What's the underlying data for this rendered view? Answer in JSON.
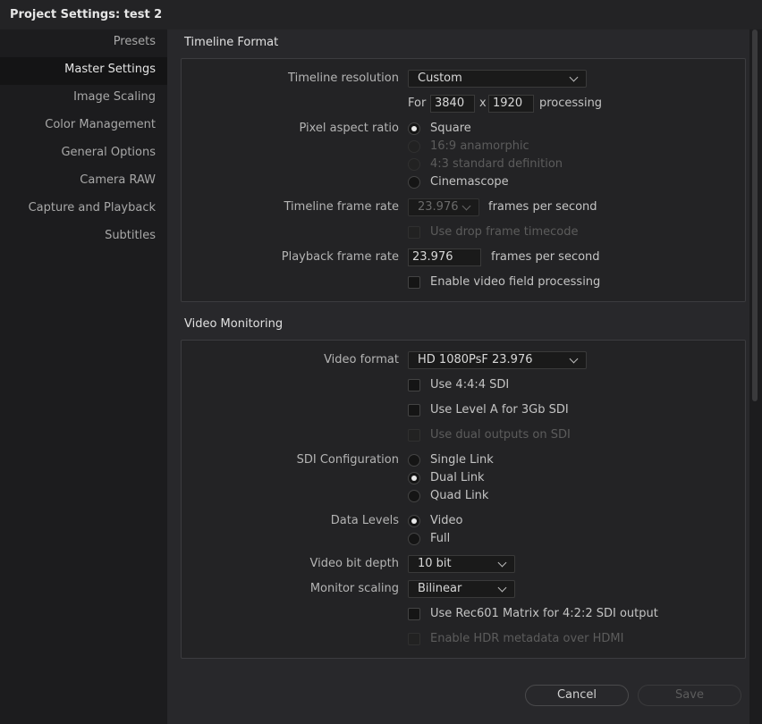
{
  "window": {
    "title": "Project Settings:  test 2"
  },
  "sidebar": {
    "items": [
      {
        "label": "Presets"
      },
      {
        "label": "Master Settings"
      },
      {
        "label": "Image Scaling"
      },
      {
        "label": "Color Management"
      },
      {
        "label": "General Options"
      },
      {
        "label": "Camera RAW"
      },
      {
        "label": "Capture and Playback"
      },
      {
        "label": "Subtitles"
      }
    ],
    "active": "Master Settings"
  },
  "timeline_format": {
    "title": "Timeline Format",
    "resolution_label": "Timeline resolution",
    "resolution_value": "Custom",
    "for_label": "For",
    "width": "3840",
    "x_label": "x",
    "height": "1920",
    "processing_label": "processing",
    "par_label": "Pixel aspect ratio",
    "par_options": [
      {
        "label": "Square",
        "selected": true,
        "enabled": true
      },
      {
        "label": "16:9 anamorphic",
        "selected": false,
        "enabled": false
      },
      {
        "label": "4:3 standard definition",
        "selected": false,
        "enabled": false
      },
      {
        "label": "Cinemascope",
        "selected": false,
        "enabled": true
      }
    ],
    "frame_rate_label": "Timeline frame rate",
    "frame_rate_value": "23.976",
    "fps_label": "frames per second",
    "drop_frame_label": "Use drop frame timecode",
    "playback_rate_label": "Playback frame rate",
    "playback_rate_value": "23.976",
    "playback_fps_label": "frames per second",
    "field_processing_label": "Enable video field processing"
  },
  "video_monitoring": {
    "title": "Video Monitoring",
    "format_label": "Video format",
    "format_value": "HD 1080PsF 23.976",
    "use_444_label": "Use 4:4:4 SDI",
    "use_level_a_label": "Use Level A for 3Gb SDI",
    "dual_outputs_label": "Use dual outputs on SDI",
    "sdi_config_label": "SDI Configuration",
    "sdi_options": [
      {
        "label": "Single Link",
        "selected": false
      },
      {
        "label": "Dual Link",
        "selected": true
      },
      {
        "label": "Quad Link",
        "selected": false
      }
    ],
    "data_levels_label": "Data Levels",
    "data_level_options": [
      {
        "label": "Video",
        "selected": true
      },
      {
        "label": "Full",
        "selected": false
      }
    ],
    "bit_depth_label": "Video bit depth",
    "bit_depth_value": "10 bit",
    "monitor_scaling_label": "Monitor scaling",
    "monitor_scaling_value": "Bilinear",
    "rec601_label": "Use Rec601 Matrix for 4:2:2 SDI output",
    "hdr_label": "Enable HDR metadata over HDMI"
  },
  "footer": {
    "cancel_label": "Cancel",
    "save_label": "Save"
  }
}
